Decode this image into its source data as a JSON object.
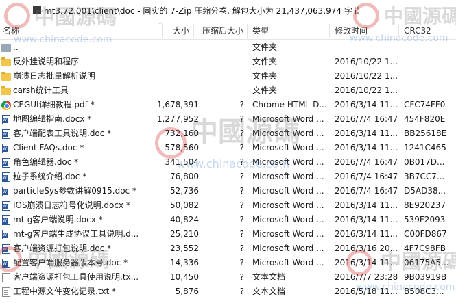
{
  "window": {
    "title": "mt3.72.001\\client\\doc - 固实的 7-Zip 压缩分卷, 解包大小为 21,437,063,974 字节"
  },
  "columns": {
    "name": "名称",
    "size": "大小",
    "packed": "压缩后大小",
    "type": "类型",
    "modified": "修改时间",
    "crc": "CRC32"
  },
  "rows": [
    {
      "icon": "up-folder-icon",
      "name": "..",
      "size": "",
      "packed": "",
      "type": "文件夹",
      "modified": "",
      "crc": ""
    },
    {
      "icon": "folder-icon",
      "name": "反外挂说明和程序",
      "size": "",
      "packed": "",
      "type": "文件夹",
      "modified": "2016/10/22 1...",
      "crc": ""
    },
    {
      "icon": "folder-icon",
      "name": "崩溃日志批量解析说明",
      "size": "",
      "packed": "",
      "type": "文件夹",
      "modified": "2016/10/22 1...",
      "crc": ""
    },
    {
      "icon": "folder-icon",
      "name": "carsh统计工具",
      "size": "",
      "packed": "",
      "type": "文件夹",
      "modified": "2016/10/22 1...",
      "crc": ""
    },
    {
      "icon": "chrome-pdf-icon",
      "name": "CEGUI详细教程.pdf *",
      "size": "1,678,391",
      "packed": "?",
      "type": "Chrome HTML D...",
      "modified": "2016/3/14 11...",
      "crc": "CFC74FF0"
    },
    {
      "icon": "word-doc-icon",
      "name": "地图编辑指南.docx *",
      "size": "1,277,952",
      "packed": "?",
      "type": "Microsoft Word ...",
      "modified": "2016/7/4 16:47",
      "crc": "454F820E"
    },
    {
      "icon": "word-doc-icon",
      "name": "客户端配表工具说明.doc *",
      "size": "732,160",
      "packed": "?",
      "type": "Microsoft Word ...",
      "modified": "2016/3/14 11...",
      "crc": "BB25618E"
    },
    {
      "icon": "word-doc-icon",
      "name": "Client FAQs.doc *",
      "size": "578,560",
      "packed": "?",
      "type": "Microsoft Word ...",
      "modified": "2016/3/14 11...",
      "crc": "1241C465"
    },
    {
      "icon": "word-doc-icon",
      "name": "角色编辑器.doc *",
      "size": "341,504",
      "packed": "?",
      "type": "Microsoft Word ...",
      "modified": "2016/7/4 16:47",
      "crc": "0B017D..."
    },
    {
      "icon": "word-doc-icon",
      "name": "粒子系统介绍.doc *",
      "size": "76,800",
      "packed": "?",
      "type": "Microsoft Word ...",
      "modified": "2016/7/4 16:47",
      "crc": "3B7CC7..."
    },
    {
      "icon": "word-doc-icon",
      "name": "particleSys参数讲解0915.doc *",
      "size": "52,736",
      "packed": "?",
      "type": "Microsoft Word ...",
      "modified": "2016/7/4 16:47",
      "crc": "D5AD38..."
    },
    {
      "icon": "word-doc-icon",
      "name": "IOS崩溃日志符号化说明.docx *",
      "size": "50,082",
      "packed": "?",
      "type": "Microsoft Word ...",
      "modified": "2016/3/14 11...",
      "crc": "8E920237"
    },
    {
      "icon": "word-doc-icon",
      "name": "mt-g客户端说明.docx *",
      "size": "40,824",
      "packed": "?",
      "type": "Microsoft Word ...",
      "modified": "2016/3/14 11...",
      "crc": "539F2093"
    },
    {
      "icon": "word-doc-icon",
      "name": "mt-g客户端生成协议工具说明.d...",
      "size": "25,210",
      "packed": "?",
      "type": "Microsoft Word ...",
      "modified": "2016/3/14 11...",
      "crc": "C00FD867"
    },
    {
      "icon": "word-doc-icon",
      "name": "客户端资源打包说明.doc *",
      "size": "23,552",
      "packed": "?",
      "type": "Microsoft Word ...",
      "modified": "2016/3/16 20...",
      "crc": "4F7C98FB"
    },
    {
      "icon": "word-doc-icon",
      "name": "配置客户端服务器版本号.doc *",
      "size": "14,336",
      "packed": "?",
      "type": "Microsoft Word ...",
      "modified": "2016/3/14 11...",
      "crc": "06175A5..."
    },
    {
      "icon": "text-doc-icon",
      "name": "客户端资源打包工具使用说明.tx...",
      "size": "10,450",
      "packed": "?",
      "type": "文本文档",
      "modified": "2016/7/7 23:28",
      "crc": "9B03919B"
    },
    {
      "icon": "text-doc-icon",
      "name": "工程中源文件变化记录.txt *",
      "size": "5,876",
      "packed": "?",
      "type": "文本文档",
      "modified": "2016/5/18 11...",
      "crc": "B508C3..."
    }
  ],
  "watermark": {
    "text": "中國源碼",
    "url": "www.chinacode.com"
  }
}
